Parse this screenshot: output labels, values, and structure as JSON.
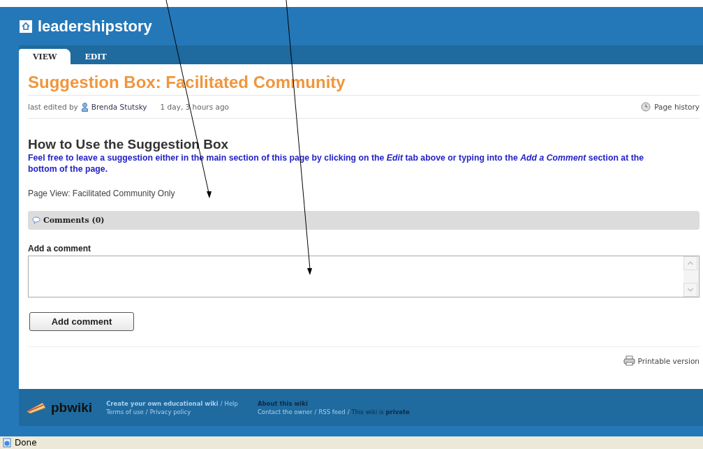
{
  "site": {
    "title": "leadershipstory"
  },
  "tabs": [
    {
      "label": "VIEW",
      "selected": true
    },
    {
      "label": "EDIT",
      "selected": false
    }
  ],
  "page": {
    "title": "Suggestion Box: Facilitated Community",
    "edited_prefix": "last edited by",
    "editor": "Brenda Stutsky",
    "edited_time": "1 day, 3 hours ago",
    "history_link": "Page history"
  },
  "content": {
    "heading": "How to Use the Suggestion Box",
    "intro": "Feel free to leave a suggestion either in the main section of this page by clicking on the *Edit* tab above or typing into the *Add a Comment* section at the bottom of the page.",
    "note": "Page View: Facilitated Community Only"
  },
  "comments": {
    "header": "Comments (0)",
    "add_label": "Add a comment",
    "button": "Add comment"
  },
  "printable_link": "Printable version",
  "footer": {
    "brand": "pbwiki",
    "separator": "/",
    "links_1": [
      {
        "label": "Create your own educational wiki"
      },
      {
        "label": "Help"
      }
    ],
    "links_2": [
      {
        "label": "Terms of use"
      },
      {
        "label": "Privacy policy"
      }
    ],
    "about_title": "About this wiki",
    "about_links": [
      {
        "label": "Contact the owner"
      },
      {
        "label": "RSS feed"
      }
    ],
    "privacy": "This wiki is **private**"
  },
  "status_bar": {
    "text": "Done"
  }
}
